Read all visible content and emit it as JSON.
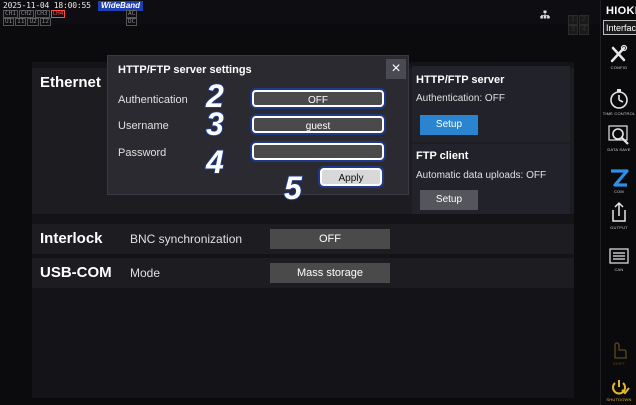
{
  "status_bar": {
    "datetime": "2025-11-04 18:00:55",
    "band": "WideBand",
    "channels_row1": [
      "CH1",
      "CH2",
      "CH3",
      "CH4"
    ],
    "channels_row2": [
      "U1",
      "I1",
      "U2",
      "I2"
    ],
    "ac_top": "AC",
    "ac_bottom": "DC",
    "channel_numbers": [
      "1",
      "2",
      "3",
      "4"
    ]
  },
  "sidebar": {
    "brand": "HIOKI",
    "interface_button": "Interface",
    "items": [
      {
        "label": "CONFIG",
        "icon": "tools-icon"
      },
      {
        "label": "TIME CONTROL",
        "icon": "stopwatch-icon"
      },
      {
        "label": "DATA SAVE",
        "icon": "magnifier-icon"
      },
      {
        "label": "COM",
        "icon": "com-icon"
      },
      {
        "label": "OUTPUT",
        "icon": "output-icon"
      },
      {
        "label": "CAN",
        "icon": "can-icon"
      },
      {
        "label": "SHIFT",
        "icon": "hand-icon"
      },
      {
        "label": "SHUTDOWN",
        "icon": "power-icon"
      }
    ]
  },
  "ethernet": {
    "label": "Ethernet",
    "http_ftp_server": {
      "title": "HTTP/FTP server",
      "status": "Authentication: OFF",
      "setup": "Setup"
    },
    "ftp_client": {
      "title": "FTP client",
      "status": "Automatic data uploads: OFF",
      "setup": "Setup"
    }
  },
  "interlock": {
    "label": "Interlock",
    "field": "BNC synchronization",
    "value": "OFF"
  },
  "usbcom": {
    "label": "USB-COM",
    "field": "Mode",
    "value": "Mass storage"
  },
  "dialog": {
    "title": "HTTP/FTP server settings",
    "authentication_label": "Authentication",
    "authentication_value": "OFF",
    "username_label": "Username",
    "username_value": "guest",
    "password_label": "Password",
    "password_value": "",
    "apply": "Apply",
    "close": "×"
  },
  "callouts": [
    "2",
    "3",
    "4",
    "5"
  ]
}
